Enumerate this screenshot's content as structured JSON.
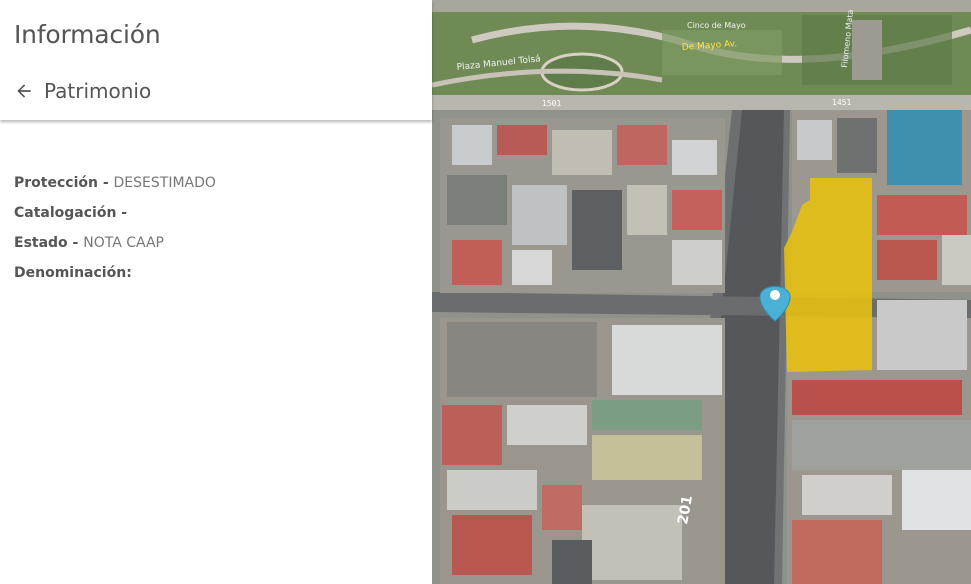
{
  "panel": {
    "title": "Información",
    "back_label": "Patrimonio",
    "properties": [
      {
        "key": "Protección",
        "value": "DESESTIMADO"
      },
      {
        "key": "Catalogación",
        "value": ""
      },
      {
        "key": "Estado",
        "value": "NOTA CAAP"
      },
      {
        "key": "Denominación",
        "value": ""
      }
    ]
  },
  "map": {
    "street_labels": [
      "Plaza Manuel Tolsá",
      "De Mayo Av.",
      "Filomeno Mata",
      "Cinco de Mayo"
    ],
    "street_numbers": [
      "1501",
      "1451",
      "201"
    ],
    "marker_icon": "map-pin-icon",
    "highlight_color": "#e8c00e",
    "marker_color": "#4bb0d6"
  }
}
